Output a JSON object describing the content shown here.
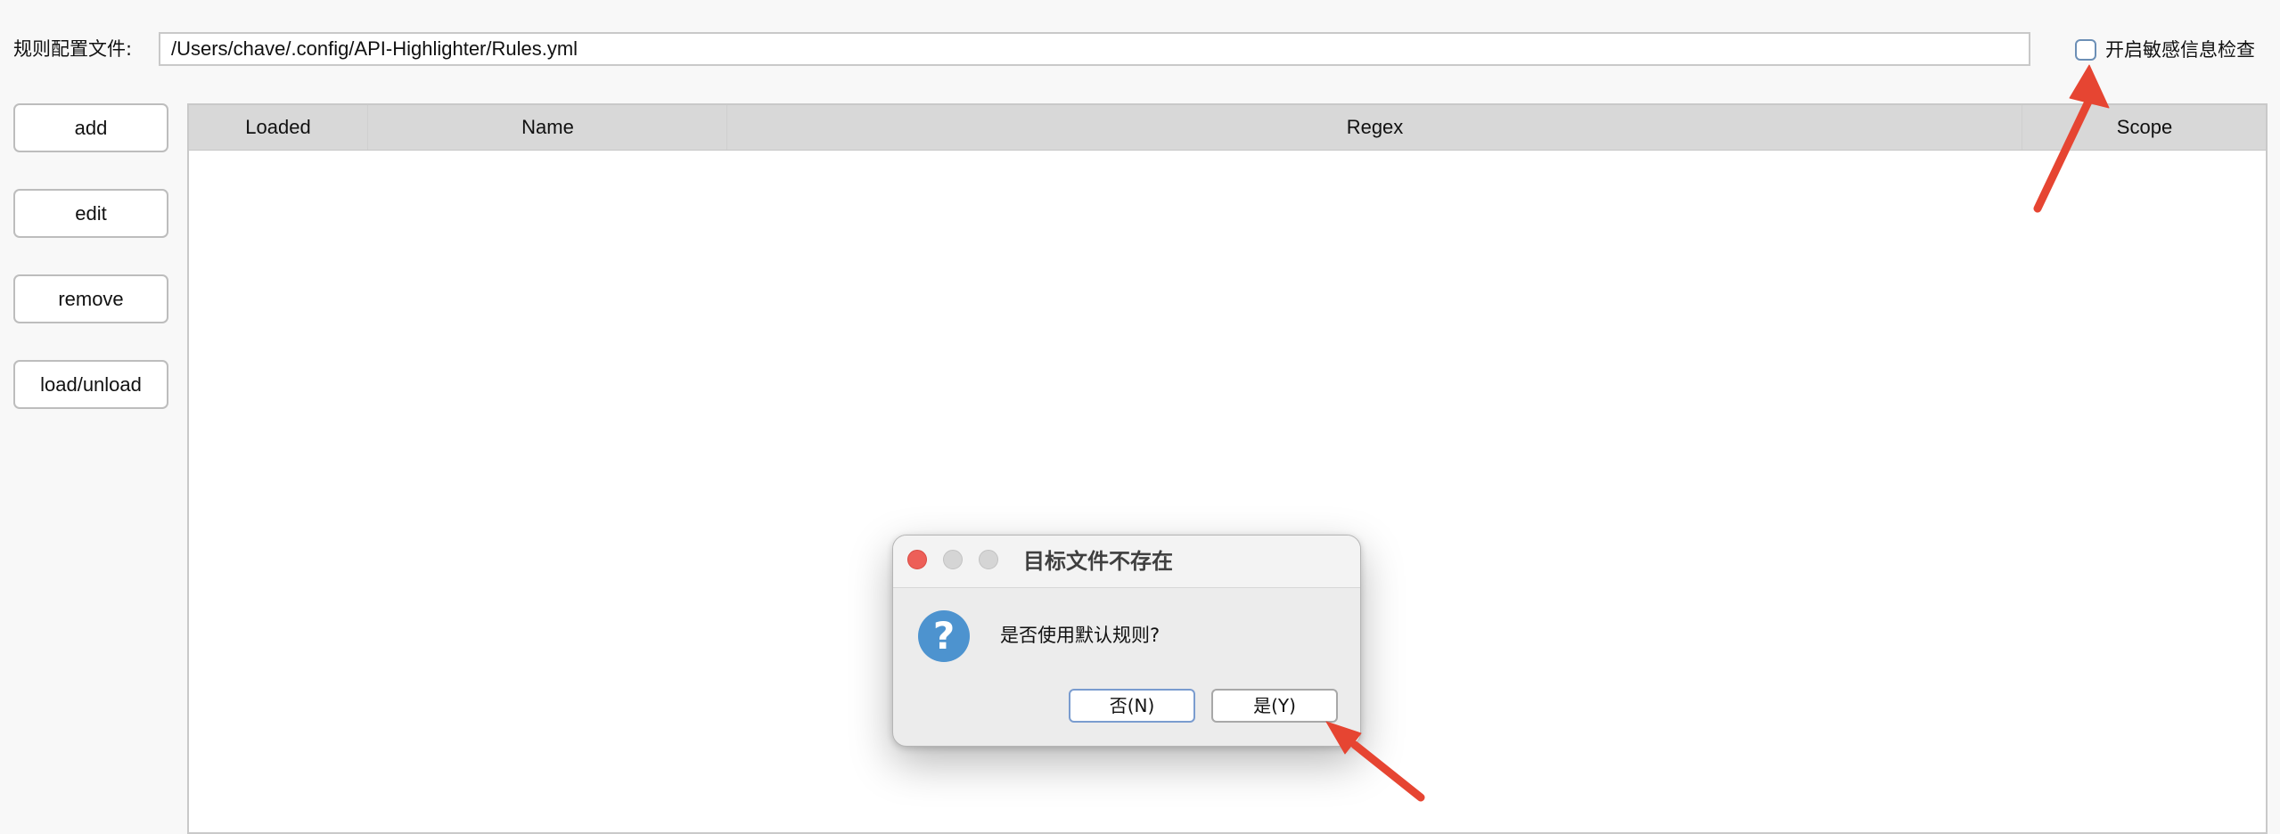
{
  "config": {
    "label": "规则配置文件:",
    "path": "/Users/chave/.config/API-Highlighter/Rules.yml"
  },
  "sensitive_check": {
    "label": "开启敏感信息检查",
    "checked": false
  },
  "sidebar": {
    "buttons": [
      {
        "label": "add"
      },
      {
        "label": "edit"
      },
      {
        "label": "remove"
      },
      {
        "label": "load/unload"
      }
    ]
  },
  "table": {
    "columns": [
      {
        "label": "Loaded"
      },
      {
        "label": "Name"
      },
      {
        "label": "Regex"
      },
      {
        "label": "Scope"
      }
    ],
    "rows": []
  },
  "dialog": {
    "title": "目标文件不存在",
    "message": "是否使用默认规则?",
    "icon": "question-icon",
    "buttons": {
      "no": "否(N)",
      "yes": "是(Y)"
    }
  },
  "annotations": {
    "arrow_color": "#e64532"
  }
}
